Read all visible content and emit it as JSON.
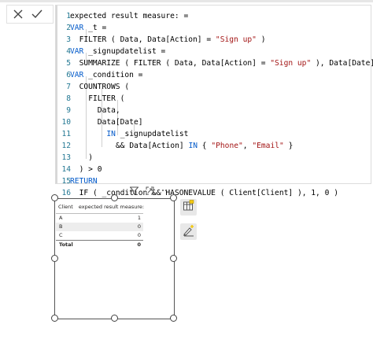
{
  "commit": {
    "cancel_icon": "close-icon",
    "confirm_icon": "checkmark-icon"
  },
  "editor": {
    "lines": [
      {
        "num": "1",
        "text": "expected result measure: ="
      },
      {
        "num": "2",
        "text": "VAR _t ="
      },
      {
        "num": "3",
        "text": "FILTER ( Data, Data[Action] = \"Sign up\" )"
      },
      {
        "num": "4",
        "text": "VAR _signupdatelist ="
      },
      {
        "num": "5",
        "text": "SUMMARIZE ( FILTER ( Data, Data[Action] = \"Sign up\" ), Data[Date] )"
      },
      {
        "num": "6",
        "text": "VAR _condition ="
      },
      {
        "num": "7",
        "text": "COUNTROWS ("
      },
      {
        "num": "8",
        "text": "FILTER ("
      },
      {
        "num": "9",
        "text": "Data,"
      },
      {
        "num": "10",
        "text": "Data[Date]"
      },
      {
        "num": "11",
        "text": "IN _signupdatelist"
      },
      {
        "num": "12",
        "text": "&& Data[Action] IN { \"Phone\", \"Email\" }"
      },
      {
        "num": "13",
        "text": ")"
      },
      {
        "num": "14",
        "text": ") > 0"
      },
      {
        "num": "15",
        "text": "RETURN"
      },
      {
        "num": "16",
        "text": "IF ( _condition && HASONEVALUE ( Client[Client] ), 1, 0 )"
      }
    ]
  },
  "visual_header": {
    "icons": [
      "filter-icon",
      "focus-mode-icon",
      "more-options-icon"
    ]
  },
  "table": {
    "headers": [
      "Client",
      "expected result measure:"
    ],
    "rows": [
      {
        "client": "A",
        "value": "1"
      },
      {
        "client": "B",
        "value": "0"
      },
      {
        "client": "C",
        "value": "0"
      }
    ],
    "total": {
      "label": "Total",
      "value": "0"
    }
  },
  "side_buttons": [
    "table-visual-icon",
    "format-visual-icon"
  ],
  "colors": {
    "keyword": "#035aca",
    "string": "#a31515",
    "line_number": "#237893",
    "row_stripe": "#ededed"
  }
}
